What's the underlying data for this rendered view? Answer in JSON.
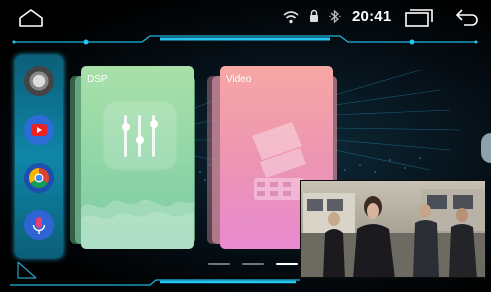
{
  "status_bar": {
    "time": "20:41",
    "icons": [
      "home-icon",
      "wifi-icon",
      "lock-icon",
      "bluetooth-icon",
      "recents-icon",
      "back-icon"
    ]
  },
  "dock": {
    "apps": [
      "camera-icon",
      "youtube-icon",
      "chrome-icon",
      "microphone-icon"
    ]
  },
  "cards": [
    {
      "label": "DSP",
      "icon": "equalizer-icon"
    },
    {
      "label": "Video",
      "icon": "film-reel-icon"
    }
  ],
  "pager": {
    "pages": 3,
    "active": 3
  },
  "colors": {
    "accent": "#1fb6e0",
    "dsp_card": "#8cd4a6",
    "video_card": "#ec94b4"
  }
}
